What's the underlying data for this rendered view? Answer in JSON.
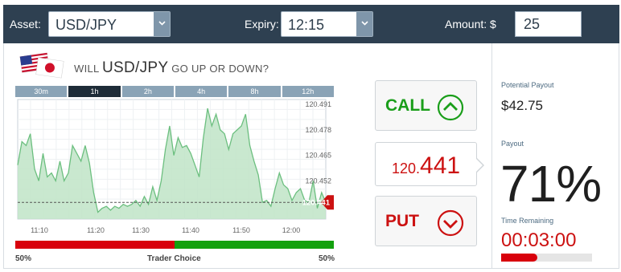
{
  "topbar": {
    "asset_label": "Asset:",
    "asset_value": "USD/JPY",
    "expiry_label": "Expiry:",
    "expiry_value": "12:15",
    "amount_label": "Amount: $",
    "amount_value": "25"
  },
  "question": {
    "prefix": "WILL",
    "pair": "USD/JPY",
    "suffix": "GO UP OR DOWN?"
  },
  "tabs": [
    {
      "label": "30m",
      "active": false
    },
    {
      "label": "1h",
      "active": true
    },
    {
      "label": "2h",
      "active": false
    },
    {
      "label": "4h",
      "active": false
    },
    {
      "label": "8h",
      "active": false
    },
    {
      "label": "12h",
      "active": false
    }
  ],
  "chart_data": {
    "type": "area",
    "x_tick_labels": [
      "11:10",
      "11:20",
      "11:30",
      "11:40",
      "11:50",
      "12:00"
    ],
    "y_tick_labels": [
      "120.491",
      "120.478",
      "120.465",
      "120.452"
    ],
    "ylim": [
      120.4325,
      120.4935
    ],
    "current_price_label": "120.441",
    "current_price": 120.441,
    "grid": true,
    "line_color": "#6cbf7f",
    "fill_color": "#bfe4c7",
    "points": [
      [
        0,
        120.46
      ],
      [
        2,
        120.472
      ],
      [
        4,
        120.47
      ],
      [
        6,
        120.476
      ],
      [
        8,
        120.458
      ],
      [
        10,
        120.452
      ],
      [
        12,
        120.466
      ],
      [
        14,
        120.454
      ],
      [
        16,
        120.456
      ],
      [
        18,
        120.452
      ],
      [
        20,
        120.462
      ],
      [
        22,
        120.452
      ],
      [
        24,
        120.456
      ],
      [
        26,
        120.47
      ],
      [
        28,
        120.466
      ],
      [
        30,
        120.462
      ],
      [
        32,
        120.47
      ],
      [
        34,
        120.461
      ],
      [
        36,
        120.446
      ],
      [
        38,
        120.436
      ],
      [
        40,
        120.438
      ],
      [
        42,
        120.439
      ],
      [
        44,
        120.437
      ],
      [
        46,
        120.439
      ],
      [
        48,
        120.438
      ],
      [
        50,
        120.44
      ],
      [
        52,
        120.439
      ],
      [
        54,
        120.44
      ],
      [
        56,
        120.442
      ],
      [
        58,
        120.439
      ],
      [
        60,
        120.444
      ],
      [
        62,
        120.44
      ],
      [
        64,
        120.449
      ],
      [
        66,
        120.442
      ],
      [
        68,
        120.452
      ],
      [
        70,
        120.468
      ],
      [
        72,
        120.48
      ],
      [
        74,
        120.465
      ],
      [
        76,
        120.474
      ],
      [
        78,
        120.469
      ],
      [
        80,
        120.47
      ],
      [
        82,
        120.466
      ],
      [
        84,
        120.46
      ],
      [
        86,
        120.454
      ],
      [
        88,
        120.474
      ],
      [
        90,
        120.489
      ],
      [
        92,
        120.48
      ],
      [
        94,
        120.486
      ],
      [
        96,
        120.478
      ],
      [
        98,
        120.476
      ],
      [
        100,
        120.468
      ],
      [
        102,
        120.476
      ],
      [
        104,
        120.478
      ],
      [
        106,
        120.48
      ],
      [
        108,
        120.486
      ],
      [
        110,
        120.47
      ],
      [
        112,
        120.462
      ],
      [
        114,
        120.455
      ],
      [
        116,
        120.441
      ],
      [
        118,
        120.442
      ],
      [
        120,
        120.439
      ],
      [
        122,
        120.448
      ],
      [
        124,
        120.456
      ],
      [
        126,
        120.45
      ],
      [
        128,
        120.448
      ],
      [
        130,
        120.442
      ],
      [
        132,
        120.446
      ],
      [
        134,
        120.448
      ],
      [
        136,
        120.442
      ],
      [
        138,
        120.441
      ],
      [
        140,
        120.452
      ],
      [
        142,
        120.438
      ],
      [
        144,
        120.446
      ],
      [
        146,
        120.441
      ]
    ]
  },
  "sentiment": {
    "left_label": "50%",
    "center_label": "Trader Choice",
    "right_label": "50%",
    "put_share": 0.5,
    "put_color": "#d8000c",
    "call_color": "#13a10e"
  },
  "call_button": {
    "label": "CALL",
    "color": "#1a9e1a",
    "icon": "chevron-up-circle-icon"
  },
  "put_button": {
    "label": "PUT",
    "color": "#cc1111",
    "icon": "chevron-down-circle-icon"
  },
  "price": {
    "prefix": "120.",
    "emphasis": "441"
  },
  "right_panel": {
    "potential_payout_label": "Potential Payout",
    "potential_payout_value": "$42.75",
    "payout_label": "Payout",
    "payout_value": "71%",
    "time_remaining_label": "Time Remaining",
    "time_remaining_value": "00:03:00",
    "time_progress": 0.4
  },
  "colors": {
    "header_bg": "#2e4051",
    "tab_bg": "#8aa3b6",
    "tab_active_bg": "#1e2c38",
    "price_tag": "#cc1111"
  }
}
